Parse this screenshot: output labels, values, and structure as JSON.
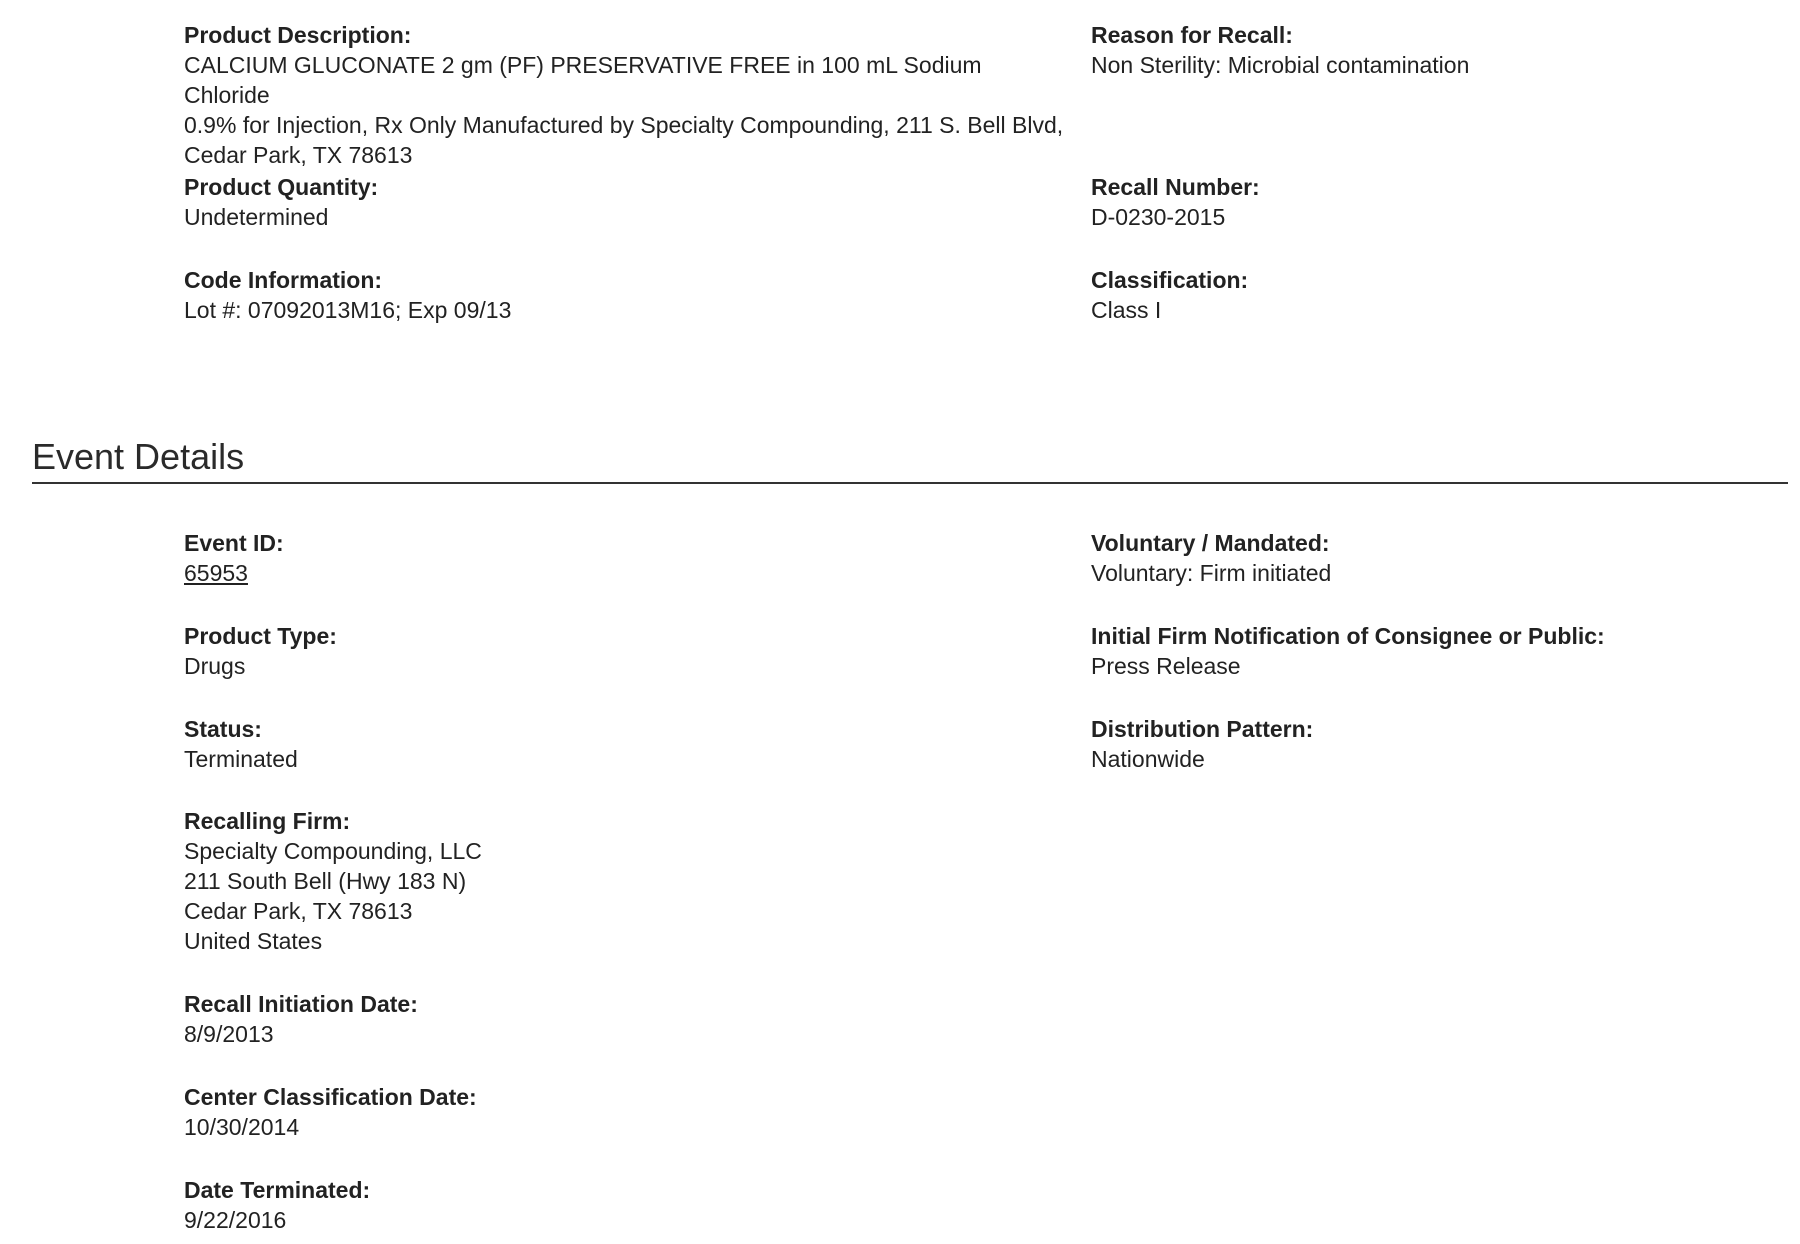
{
  "product": {
    "description": {
      "label": "Product Description:",
      "lines": [
        "CALCIUM GLUCONATE 2 gm (PF) PRESERVATIVE FREE in 100 mL Sodium Chloride",
        "0.9% for Injection, Rx Only Manufactured by Specialty Compounding, 211 S. Bell Blvd,",
        "Cedar Park, TX 78613"
      ]
    },
    "reason": {
      "label": "Reason for Recall:",
      "value": "Non Sterility: Microbial contamination"
    },
    "quantity": {
      "label": "Product Quantity:",
      "value": "Undetermined"
    },
    "recall_number": {
      "label": "Recall Number:",
      "value": "D-0230-2015"
    },
    "code_info": {
      "label": "Code Information:",
      "value": "Lot #: 07092013M16; Exp 09/13"
    },
    "classification": {
      "label": "Classification:",
      "value": "Class I"
    }
  },
  "event": {
    "heading": "Event Details",
    "event_id": {
      "label": "Event ID:",
      "value": "65953"
    },
    "voluntary": {
      "label": "Voluntary / Mandated:",
      "value": "Voluntary: Firm initiated"
    },
    "product_type": {
      "label": "Product Type:",
      "value": "Drugs"
    },
    "notification": {
      "label": "Initial Firm Notification of Consignee or Public:",
      "value": "Press Release"
    },
    "status": {
      "label": "Status:",
      "value": "Terminated"
    },
    "distribution": {
      "label": "Distribution Pattern:",
      "value": "Nationwide"
    },
    "firm": {
      "label": "Recalling Firm:",
      "lines": [
        "Specialty Compounding, LLC",
        "211 South Bell (Hwy 183 N)",
        "Cedar Park, TX 78613",
        "United States"
      ]
    },
    "initiation_date": {
      "label": "Recall Initiation Date:",
      "value": "8/9/2013"
    },
    "center_date": {
      "label": "Center Classification Date:",
      "value": "10/30/2014"
    },
    "terminated_date": {
      "label": "Date Terminated:",
      "value": "9/22/2016"
    }
  }
}
